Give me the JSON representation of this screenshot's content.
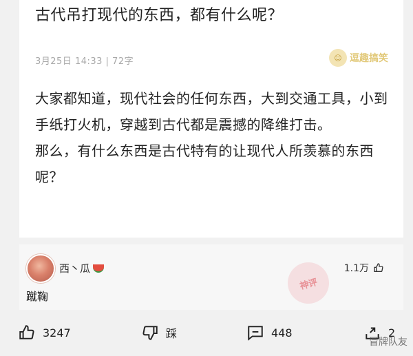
{
  "post": {
    "title": "古代吊打现代的东西，都有什么呢？",
    "meta": "3月25日  14:33 | 72字",
    "brand": "逗趣搞笑",
    "paragraphs": [
      "大家都知道，现代社会的任何东西，大到交通工具，小到手纸打火机，穿越到古代都是震撼的降维打击。",
      "那么，有什么东西是古代特有的让现代人所羡慕的东西呢？"
    ]
  },
  "comment": {
    "username": "西丶瓜",
    "text": "蹴鞠",
    "likes": "1.1万"
  },
  "actions": {
    "like_count": "3247",
    "dislike_label": "踩",
    "comment_count": "448",
    "share_count": "2"
  },
  "watermark": "冒牌队友",
  "icons": [
    "thumb-up-icon",
    "thumb-down-icon",
    "comment-icon",
    "share-icon",
    "watermelon-icon"
  ]
}
